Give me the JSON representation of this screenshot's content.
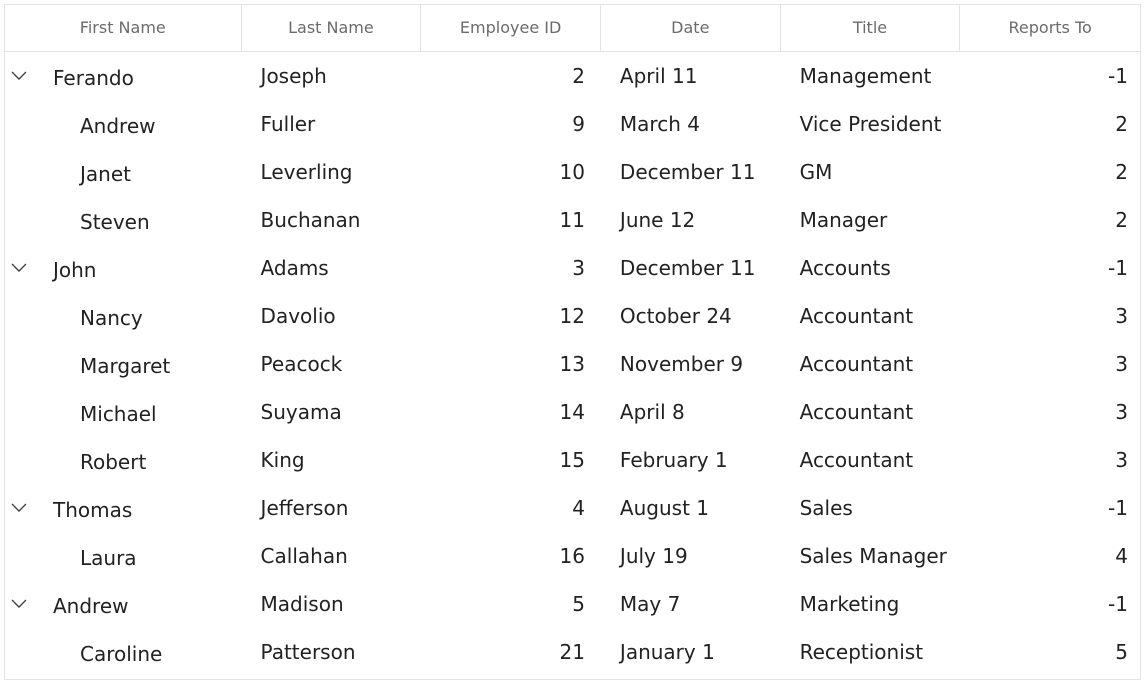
{
  "columns": [
    "First Name",
    "Last Name",
    "Employee ID",
    "Date",
    "Title",
    "Reports To"
  ],
  "rows": [
    {
      "level": 0,
      "expanded": true,
      "first": "Ferando",
      "last": "Joseph",
      "id": "2",
      "date": "April 11",
      "title": "Management",
      "reports": "-1"
    },
    {
      "level": 1,
      "first": "Andrew",
      "last": "Fuller",
      "id": "9",
      "date": "March 4",
      "title": "Vice President",
      "reports": "2"
    },
    {
      "level": 1,
      "first": "Janet",
      "last": "Leverling",
      "id": "10",
      "date": "December 11",
      "title": "GM",
      "reports": "2"
    },
    {
      "level": 1,
      "first": "Steven",
      "last": "Buchanan",
      "id": "11",
      "date": "June 12",
      "title": "Manager",
      "reports": "2"
    },
    {
      "level": 0,
      "expanded": true,
      "first": "John",
      "last": "Adams",
      "id": "3",
      "date": "December 11",
      "title": "Accounts",
      "reports": "-1"
    },
    {
      "level": 1,
      "first": "Nancy",
      "last": "Davolio",
      "id": "12",
      "date": "October 24",
      "title": "Accountant",
      "reports": "3"
    },
    {
      "level": 1,
      "first": "Margaret",
      "last": "Peacock",
      "id": "13",
      "date": "November 9",
      "title": "Accountant",
      "reports": "3"
    },
    {
      "level": 1,
      "first": "Michael",
      "last": "Suyama",
      "id": "14",
      "date": "April 8",
      "title": "Accountant",
      "reports": "3"
    },
    {
      "level": 1,
      "first": "Robert",
      "last": "King",
      "id": "15",
      "date": "February 1",
      "title": "Accountant",
      "reports": "3"
    },
    {
      "level": 0,
      "expanded": true,
      "first": "Thomas",
      "last": "Jefferson",
      "id": "4",
      "date": "August 1",
      "title": "Sales",
      "reports": "-1"
    },
    {
      "level": 1,
      "first": "Laura",
      "last": "Callahan",
      "id": "16",
      "date": "July 19",
      "title": "Sales Manager",
      "reports": "4"
    },
    {
      "level": 0,
      "expanded": true,
      "first": "Andrew",
      "last": "Madison",
      "id": "5",
      "date": "May 7",
      "title": "Marketing",
      "reports": "-1"
    },
    {
      "level": 1,
      "first": "Caroline",
      "last": "Patterson",
      "id": "21",
      "date": "January 1",
      "title": "Receptionist",
      "reports": "5"
    }
  ],
  "icons": {
    "expand": "chevron-down-icon"
  },
  "colors": {
    "border": "#e3e3e3",
    "header_text": "#6b6b6b",
    "cell_text": "#222222"
  }
}
